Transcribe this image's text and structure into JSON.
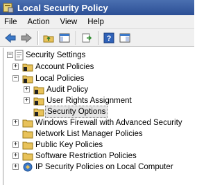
{
  "window": {
    "title": "Local Security Policy"
  },
  "menu": {
    "file": "File",
    "action": "Action",
    "view": "View",
    "help": "Help"
  },
  "tree": {
    "root": "Security Settings",
    "account_policies": "Account Policies",
    "local_policies": "Local Policies",
    "audit_policy": "Audit Policy",
    "user_rights": "User Rights Assignment",
    "security_options": "Security Options",
    "firewall": "Windows Firewall with Advanced Security",
    "network_list": "Network List Manager Policies",
    "public_key": "Public Key Policies",
    "software_restriction": "Software Restriction Policies",
    "ipsec": "IP Security Policies on Local Computer",
    "expander_collapsed": "+",
    "expander_expanded": "−"
  },
  "colors": {
    "titlebar": "#2c4f95",
    "folder": "#e8c25a",
    "selection": "#e5e5e5"
  }
}
